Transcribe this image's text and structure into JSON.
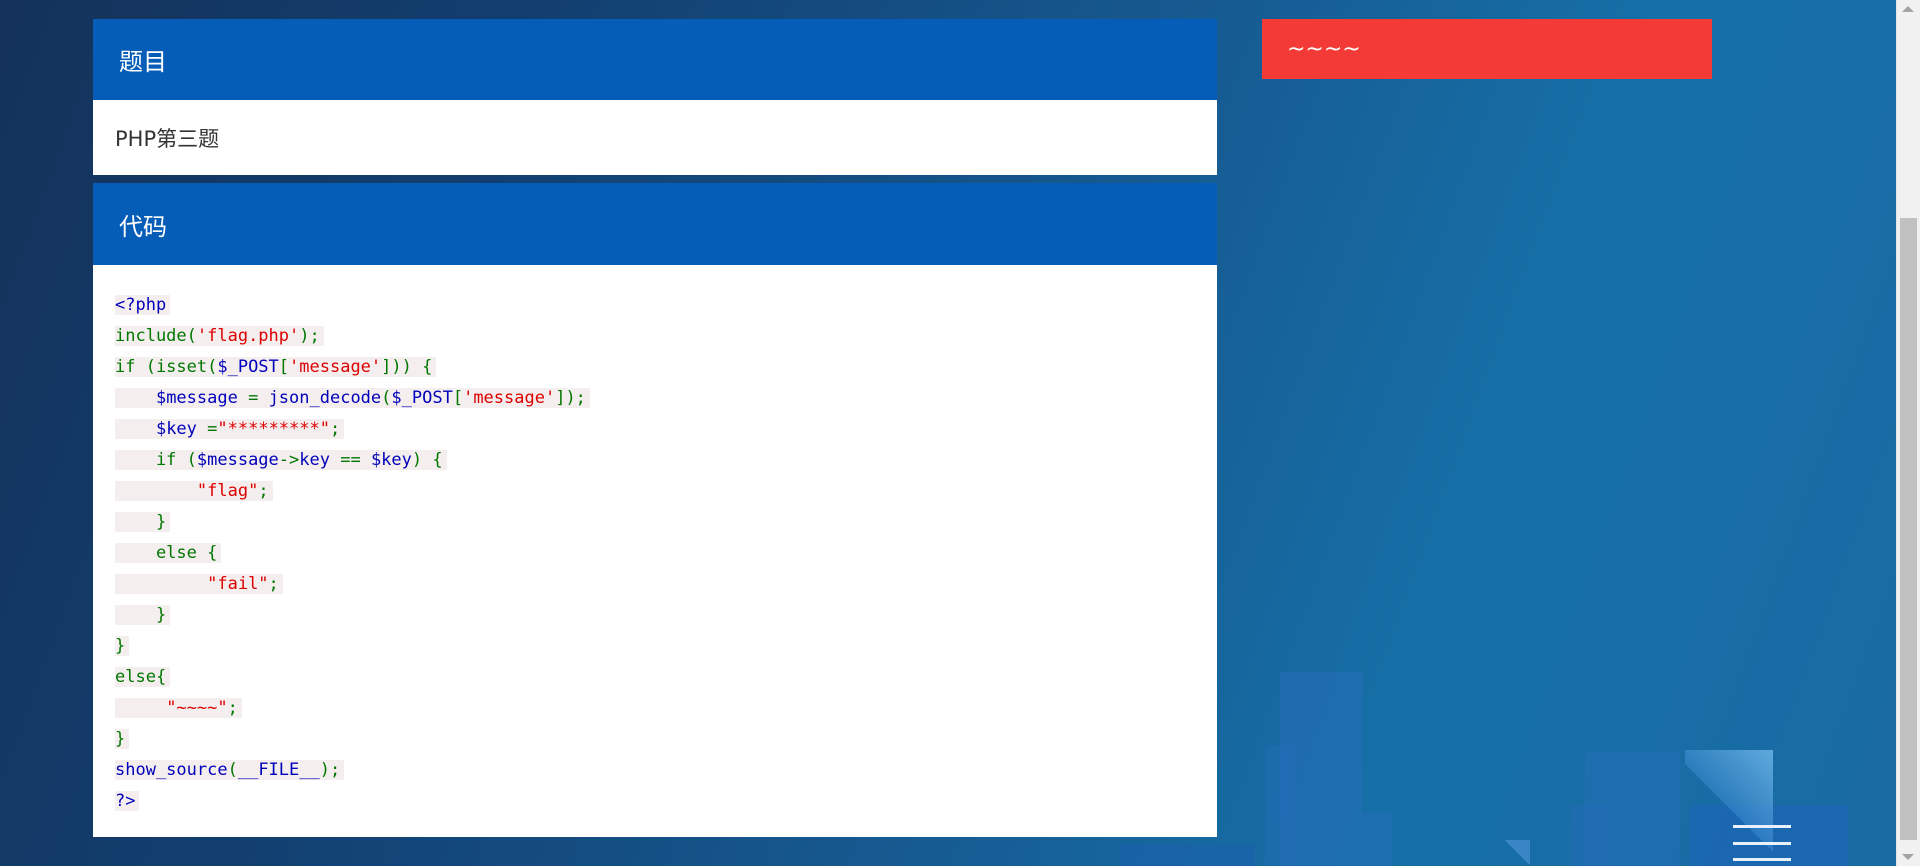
{
  "problem_panel": {
    "header": "题目",
    "content": "PHP第三题"
  },
  "code_panel": {
    "header": "代码",
    "lines": [
      [
        {
          "t": "<?php",
          "c": "default"
        }
      ],
      [
        {
          "t": "include(",
          "c": "keyword"
        },
        {
          "t": "'flag.php'",
          "c": "string"
        },
        {
          "t": ");",
          "c": "keyword"
        }
      ],
      [
        {
          "t": "if (isset(",
          "c": "keyword"
        },
        {
          "t": "$_POST",
          "c": "default"
        },
        {
          "t": "[",
          "c": "keyword"
        },
        {
          "t": "'message'",
          "c": "string"
        },
        {
          "t": "])) {",
          "c": "keyword"
        }
      ],
      [
        {
          "t": "    ",
          "c": "keyword"
        },
        {
          "t": "$message ",
          "c": "default"
        },
        {
          "t": "= ",
          "c": "keyword"
        },
        {
          "t": "json_decode",
          "c": "default"
        },
        {
          "t": "(",
          "c": "keyword"
        },
        {
          "t": "$_POST",
          "c": "default"
        },
        {
          "t": "[",
          "c": "keyword"
        },
        {
          "t": "'message'",
          "c": "string"
        },
        {
          "t": "]);",
          "c": "keyword"
        }
      ],
      [
        {
          "t": "    ",
          "c": "keyword"
        },
        {
          "t": "$key ",
          "c": "default"
        },
        {
          "t": "=",
          "c": "keyword"
        },
        {
          "t": "\"*********\"",
          "c": "string"
        },
        {
          "t": ";",
          "c": "keyword"
        }
      ],
      [
        {
          "t": "    if (",
          "c": "keyword"
        },
        {
          "t": "$message",
          "c": "default"
        },
        {
          "t": "->",
          "c": "keyword"
        },
        {
          "t": "key ",
          "c": "default"
        },
        {
          "t": "== ",
          "c": "keyword"
        },
        {
          "t": "$key",
          "c": "default"
        },
        {
          "t": ") {",
          "c": "keyword"
        }
      ],
      [
        {
          "t": "        ",
          "c": "keyword"
        },
        {
          "t": "\"flag\"",
          "c": "string"
        },
        {
          "t": ";",
          "c": "keyword"
        }
      ],
      [
        {
          "t": "    }",
          "c": "keyword"
        }
      ],
      [
        {
          "t": "    else {",
          "c": "keyword"
        }
      ],
      [
        {
          "t": "         ",
          "c": "keyword"
        },
        {
          "t": "\"fail\"",
          "c": "string"
        },
        {
          "t": ";",
          "c": "keyword"
        }
      ],
      [
        {
          "t": "    }",
          "c": "keyword"
        }
      ],
      [
        {
          "t": "}",
          "c": "keyword"
        }
      ],
      [
        {
          "t": "else{",
          "c": "keyword"
        }
      ],
      [
        {
          "t": "     ",
          "c": "keyword"
        },
        {
          "t": "\"~~~~\"",
          "c": "string"
        },
        {
          "t": ";",
          "c": "keyword"
        }
      ],
      [
        {
          "t": "}",
          "c": "keyword"
        }
      ],
      [
        {
          "t": "show_source",
          "c": "default"
        },
        {
          "t": "(",
          "c": "keyword"
        },
        {
          "t": "__FILE__",
          "c": "default"
        },
        {
          "t": ");",
          "c": "keyword"
        }
      ],
      [
        {
          "t": "?>",
          "c": "default"
        }
      ]
    ]
  },
  "notice": {
    "text": "~~~~"
  },
  "menu_button": {
    "icon": "hamburger-menu-icon"
  },
  "colors": {
    "panel_header": "#055db7",
    "notice_bg": "#f33a36",
    "code_default": "#0000bb",
    "code_keyword": "#007700",
    "code_string": "#dd0000",
    "code_line_bg": "#f5eeee"
  }
}
